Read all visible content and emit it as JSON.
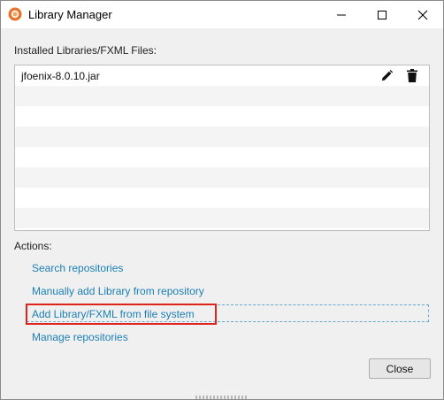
{
  "window": {
    "title": "Library Manager",
    "app_icon": "scene-builder-icon",
    "controls": [
      "minimize-icon",
      "maximize-icon",
      "close-icon"
    ]
  },
  "installed": {
    "label": "Installed Libraries/FXML Files:",
    "items": [
      {
        "name": "jfoenix-8.0.10.jar",
        "actions": [
          "edit-icon",
          "delete-icon"
        ]
      }
    ]
  },
  "actions": {
    "label": "Actions:",
    "search": "Search repositories",
    "manual_add": "Manually add Library from repository",
    "add_from_file": "Add Library/FXML from file system",
    "manage": "Manage repositories"
  },
  "footer": {
    "close_label": "Close"
  },
  "colors": {
    "link": "#1b7fb5",
    "highlight": "#e0241b",
    "focus": "#65a9d4",
    "icon_accent": "#e8742c"
  }
}
